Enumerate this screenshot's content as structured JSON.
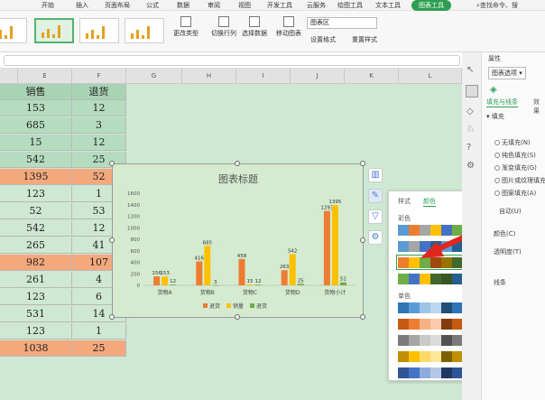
{
  "menu": {
    "items": [
      "开始",
      "插入",
      "页面布局",
      "公式",
      "数据",
      "审阅",
      "视图",
      "开发工具",
      "云服务",
      "绘图工具",
      "文本工具"
    ],
    "active": "图表工具",
    "search": "查找命令、搜"
  },
  "ribbon": {
    "change_type": "更改类型",
    "switch_row_col": "切换行列",
    "select_data": "选择数据",
    "move_chart": "移动图表",
    "chart_area_select": "图表区",
    "format_selection": "设置格式",
    "reset_style": "重置样式"
  },
  "sheet": {
    "columns": [
      "E",
      "F",
      "G",
      "H",
      "I",
      "J",
      "K",
      "L"
    ],
    "header": {
      "sales": "销售",
      "returns": "退货"
    },
    "rows": [
      {
        "sales": "153",
        "returns": "12",
        "style": "green"
      },
      {
        "sales": "685",
        "returns": "3",
        "style": "green"
      },
      {
        "sales": "15",
        "returns": "12",
        "style": "green"
      },
      {
        "sales": "542",
        "returns": "25",
        "style": "green"
      },
      {
        "sales": "1395",
        "returns": "52",
        "style": "orange"
      },
      {
        "sales": "123",
        "returns": "1",
        "style": "plain"
      },
      {
        "sales": "52",
        "returns": "53",
        "style": "plain"
      },
      {
        "sales": "542",
        "returns": "12",
        "style": "plain"
      },
      {
        "sales": "265",
        "returns": "41",
        "style": "plain"
      },
      {
        "sales": "982",
        "returns": "107",
        "style": "orange"
      },
      {
        "sales": "261",
        "returns": "4",
        "style": "plain"
      },
      {
        "sales": "123",
        "returns": "6",
        "style": "plain"
      },
      {
        "sales": "531",
        "returns": "14",
        "style": "plain"
      },
      {
        "sales": "123",
        "returns": "1",
        "style": "plain"
      },
      {
        "sales": "1038",
        "returns": "25",
        "style": "orange"
      }
    ]
  },
  "chart_data": {
    "type": "bar",
    "title": "图表标题",
    "categories": [
      "货物A",
      "货物B",
      "货物C",
      "货物D",
      "货物小计"
    ],
    "series": [
      {
        "name": "退货",
        "values": [
          156,
          416,
          458,
          263,
          1293
        ],
        "color": "#ed7d31"
      },
      {
        "name": "销量",
        "values": [
          153,
          685,
          15,
          542,
          1395
        ],
        "color": "#ffc000"
      },
      {
        "name": "退货",
        "values": [
          12,
          3,
          12,
          25,
          52
        ],
        "color": "#70ad47"
      }
    ],
    "y_ticks": [
      "1600",
      "1400",
      "1200",
      "1000",
      "800",
      "600",
      "400",
      "200",
      "0"
    ],
    "ylim": [
      0,
      1600
    ],
    "legend": "bottom"
  },
  "popup": {
    "tab_style": "样式",
    "tab_color": "颜色",
    "section_multicolor": "彩色",
    "section_mono": "单色",
    "multicolor_rows": [
      [
        "#5b9bd5",
        "#ed7d31",
        "#a5a5a5",
        "#ffc000",
        "#4472c4",
        "#70ad47",
        "#255e91",
        "#9e480e"
      ],
      [
        "#5b9bd5",
        "#a5a5a5",
        "#4472c4",
        "#255e91",
        "#5b9bd5",
        "#255e91",
        "#264478",
        "#7f7f7f"
      ],
      [
        "#ed7d31",
        "#ffc000",
        "#70ad47",
        "#9e480e",
        "#997300",
        "#43682b",
        "#f4b183",
        "#ffd966"
      ],
      [
        "#70ad47",
        "#4472c4",
        "#ffc000",
        "#43682b",
        "#375623",
        "#255e91",
        "#a9d18e",
        "#8faadc"
      ]
    ],
    "mono_rows": [
      [
        "#2e75b6",
        "#5b9bd5",
        "#9dc3e6",
        "#bdd7ee",
        "#1f4e79",
        "#2e75b6",
        "#5b9bd5",
        "#9dc3e6"
      ],
      [
        "#c55a11",
        "#ed7d31",
        "#f4b183",
        "#f8cbad",
        "#843c0c",
        "#c55a11",
        "#ed7d31",
        "#f4b183"
      ],
      [
        "#7b7b7b",
        "#a5a5a5",
        "#c9c9c9",
        "#dbdbdb",
        "#525252",
        "#7b7b7b",
        "#a5a5a5",
        "#c9c9c9"
      ],
      [
        "#bf9000",
        "#ffc000",
        "#ffd966",
        "#ffe699",
        "#7f6000",
        "#bf9000",
        "#ffc000",
        "#ffd966"
      ],
      [
        "#2f5597",
        "#4472c4",
        "#8faadc",
        "#b4c7e7",
        "#203864",
        "#2f5597",
        "#4472c4",
        "#8faadc"
      ]
    ]
  },
  "props": {
    "title": "属性",
    "dropdown": "图表选项",
    "tab_fill_line": "填充与线条",
    "tab_effects": "效果",
    "section_fill": "填充",
    "options": [
      "无填充(N)",
      "纯色填充(S)",
      "渐变填充(G)",
      "图片或纹理填充",
      "图案填充(A)"
    ],
    "auto": "自动(U)",
    "color": "颜色(C)",
    "transparency": "透明度(T)",
    "line": "线条"
  }
}
